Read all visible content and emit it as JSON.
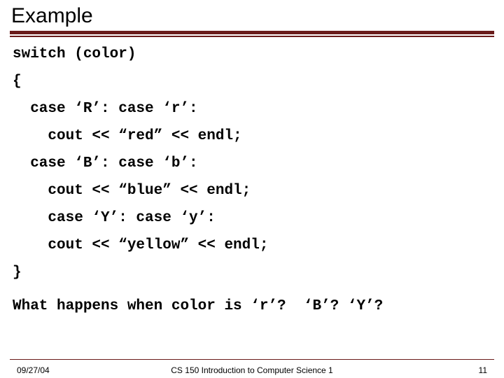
{
  "title": "Example",
  "code": {
    "l1": "switch (color)",
    "l2": "{",
    "l3": "  case ‘R’: case ‘r’:",
    "l4": "    cout << “red” << endl;",
    "l5": "  case ‘B’: case ‘b’:",
    "l6": "    cout << “blue” << endl;",
    "l7": "    case ‘Y’: case ‘y’:",
    "l8": "    cout << “yellow” << endl;",
    "l9": "}"
  },
  "question": "What happens when color is ‘r’?  ‘B’? ‘Y’?",
  "footer": {
    "date": "09/27/04",
    "course": "CS 150 Introduction to Computer Science 1",
    "page": "11"
  }
}
